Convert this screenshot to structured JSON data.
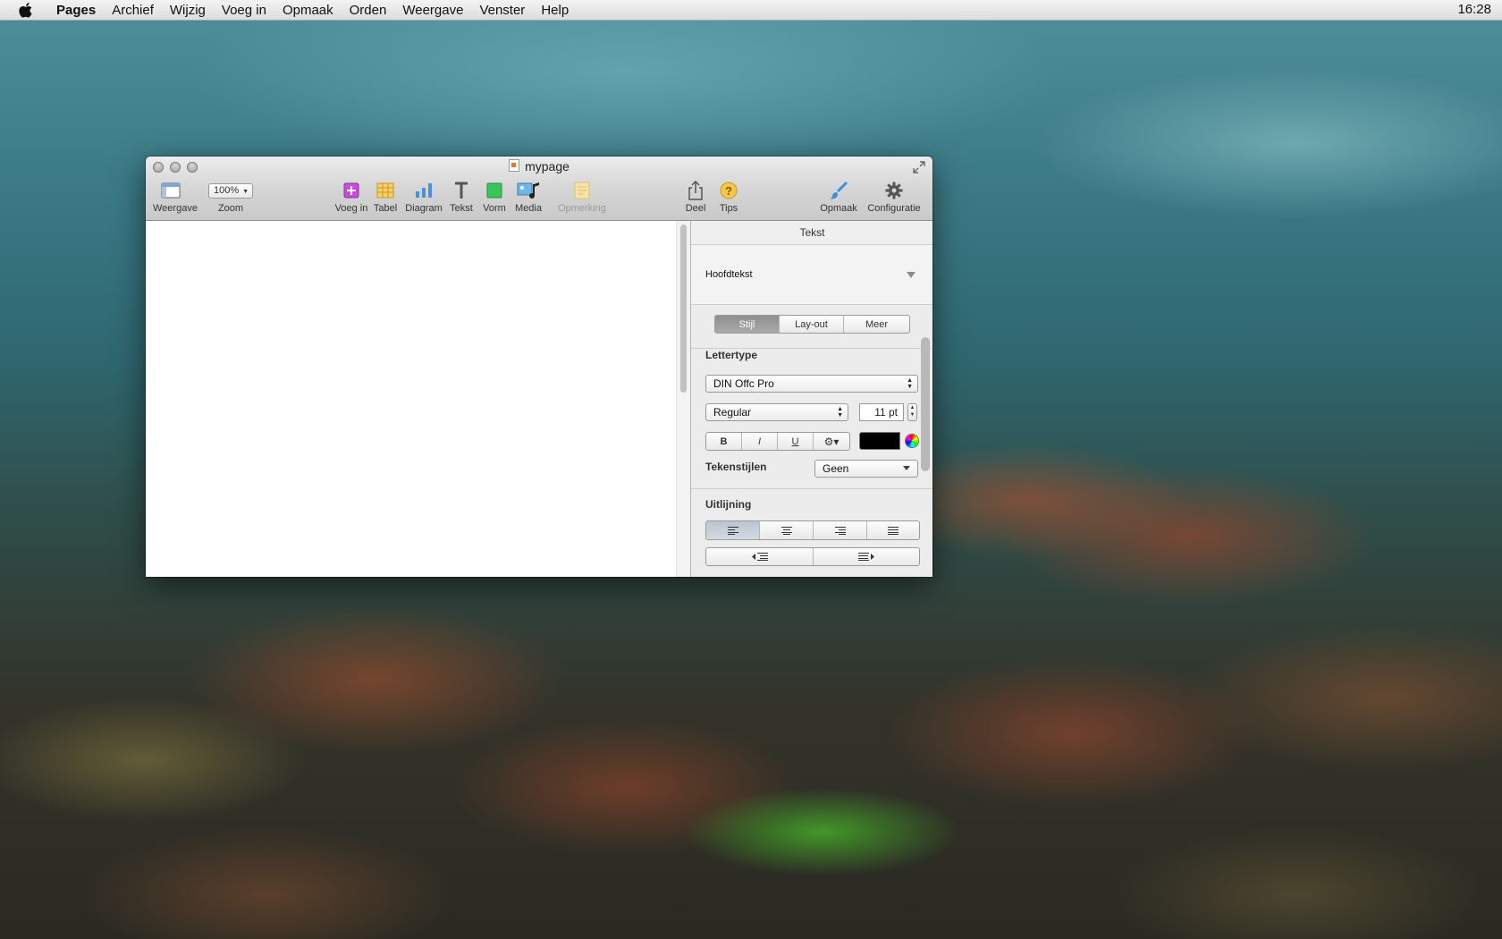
{
  "menubar": {
    "app": "Pages",
    "items": [
      "Archief",
      "Wijzig",
      "Voeg in",
      "Opmaak",
      "Orden",
      "Weergave",
      "Venster",
      "Help"
    ],
    "clock": "16:28"
  },
  "window": {
    "title": "mypage",
    "toolbar": {
      "weergave": "Weergave",
      "zoom_value": "100%",
      "zoom": "Zoom",
      "voeg_in": "Voeg in",
      "tabel": "Tabel",
      "diagram": "Diagram",
      "tekst": "Tekst",
      "vorm": "Vorm",
      "media": "Media",
      "opmerking": "Opmerking",
      "deel": "Deel",
      "tips": "Tips",
      "opmaak": "Opmaak",
      "configuratie": "Configuratie"
    }
  },
  "inspector": {
    "header": "Tekst",
    "paragraph_style": "Hoofdtekst",
    "tabs": [
      "Stijl",
      "Lay-out",
      "Meer"
    ],
    "selected_tab": "Stijl",
    "font_section": "Lettertype",
    "font_family": "DIN Offc Pro",
    "font_typeface": "Regular",
    "font_size": "11 pt",
    "style_buttons": [
      "B",
      "I",
      "U"
    ],
    "text_color": "#000000",
    "char_styles_label": "Tekenstijlen",
    "char_styles_value": "Geen",
    "alignment_section": "Uitlijning"
  }
}
